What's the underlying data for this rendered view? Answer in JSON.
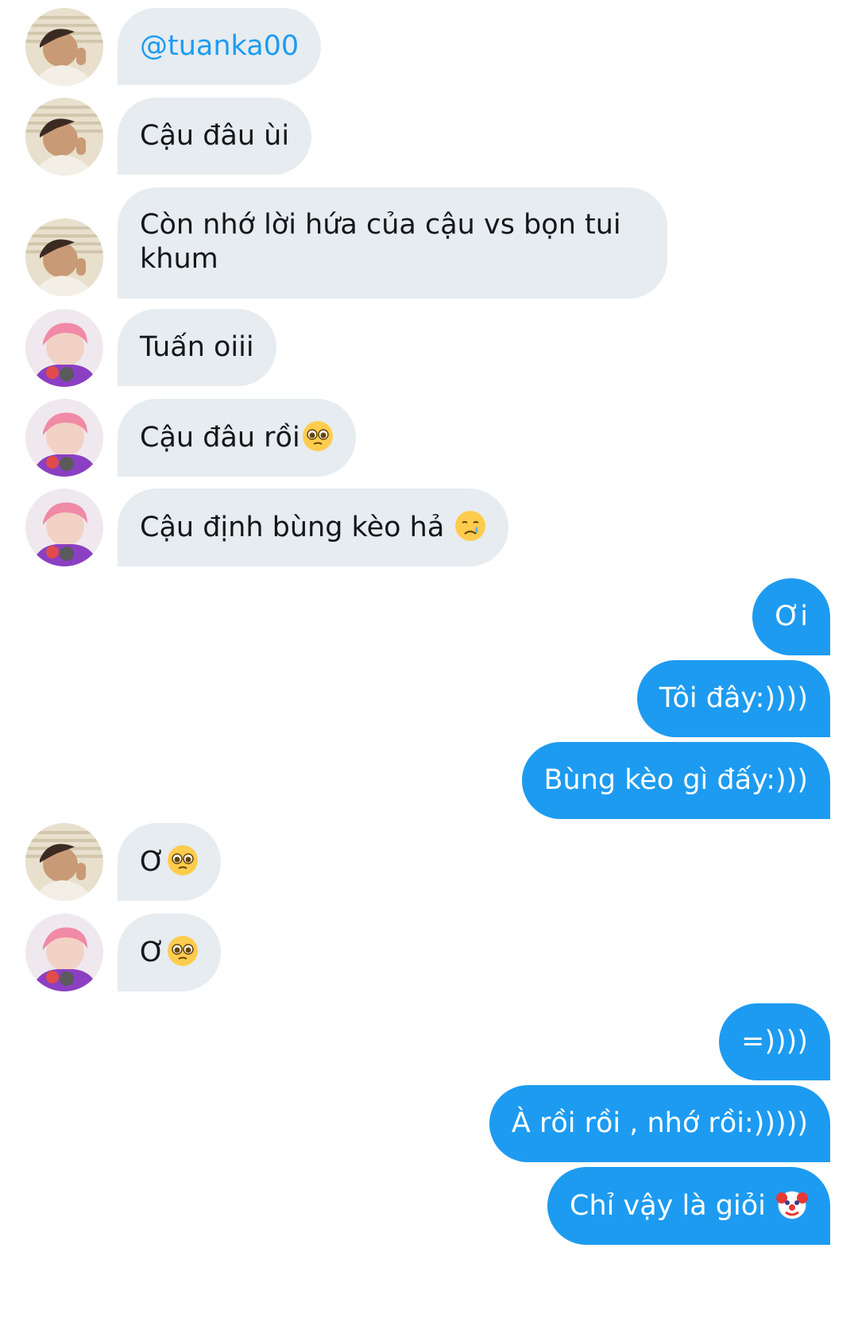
{
  "conversation": {
    "colors": {
      "incoming_bubble": "#e6ecf0",
      "outgoing_bubble": "#1d9bf0",
      "mention": "#1d9bf0",
      "incoming_text": "#14171a",
      "outgoing_text": "#ffffff"
    },
    "participants": {
      "a": {
        "avatar_icon": "user-avatar-dark-hair"
      },
      "b": {
        "avatar_icon": "user-avatar-pink-hair"
      }
    },
    "messages": [
      {
        "from": "a",
        "text": "@tuanka00"
      },
      {
        "from": "a",
        "text": "Cậu đâu ùi"
      },
      {
        "from": "a",
        "text": "Còn nhớ lời hứa của cậu vs bọn tui khum"
      },
      {
        "from": "b",
        "text": "Tuấn oiii"
      },
      {
        "from": "b",
        "text": "Cậu đâu rồi",
        "emoji": "pleading-face-emoji"
      },
      {
        "from": "b",
        "text": "Cậu định bùng kèo hả ",
        "emoji": "crying-face-emoji"
      },
      {
        "from": "me",
        "text": "Ơi"
      },
      {
        "from": "me",
        "text": "Tôi đây:))))"
      },
      {
        "from": "me",
        "text": "Bùng kèo gì đấy:)))"
      },
      {
        "from": "a",
        "text": "Ơ",
        "emoji": "pleading-face-emoji"
      },
      {
        "from": "b",
        "text": "Ơ",
        "emoji": "pleading-face-emoji"
      },
      {
        "from": "me",
        "text": "=))))"
      },
      {
        "from": "me",
        "text": "À rồi rồi , nhớ rồi:)))))"
      },
      {
        "from": "me",
        "text": "Chỉ vậy là giỏi ",
        "emoji": "clown-face-emoji"
      }
    ]
  }
}
